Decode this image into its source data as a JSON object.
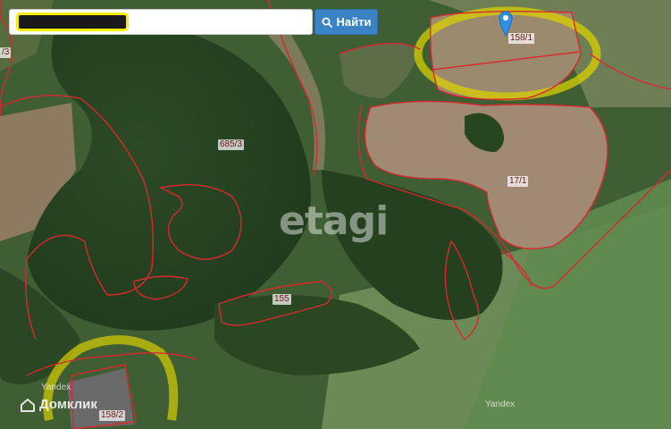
{
  "search": {
    "placeholder": "",
    "value": ""
  },
  "find_button": {
    "label": "Найти",
    "icon": "search-icon"
  },
  "map": {
    "parcels": [
      {
        "id": "158-1",
        "label": "158/1"
      },
      {
        "id": "685-3",
        "label": "685/3"
      },
      {
        "id": "17-1",
        "label": "17/1"
      },
      {
        "id": "155",
        "label": "155"
      },
      {
        "id": "158-2",
        "label": "158/2"
      },
      {
        "id": "3",
        "label": "/3"
      }
    ],
    "watermark": "etagi",
    "attribution_left": "Yandex",
    "attribution_right": "Yandex",
    "brand": "Домклик",
    "marker_icon": "map-pin-icon",
    "colors": {
      "boundary": "#d9282f",
      "highlight": "#d8cf00",
      "pin": "#2f8fe0",
      "button": "#3a84c6"
    }
  }
}
